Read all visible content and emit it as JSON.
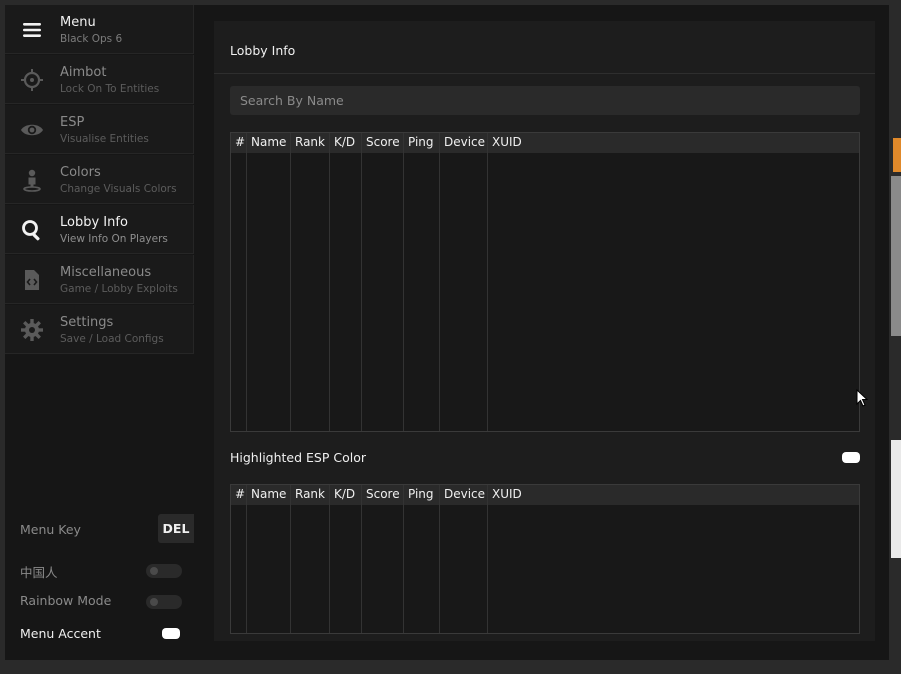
{
  "sidebar": {
    "header": {
      "title": "Menu",
      "subtitle": "Black Ops 6"
    },
    "items": [
      {
        "title": "Aimbot",
        "subtitle": "Lock On To Entities"
      },
      {
        "title": "ESP",
        "subtitle": "Visualise Entities"
      },
      {
        "title": "Colors",
        "subtitle": "Change Visuals Colors"
      },
      {
        "title": "Lobby Info",
        "subtitle": "View Info On Players"
      },
      {
        "title": "Miscellaneous",
        "subtitle": "Game / Lobby Exploits"
      },
      {
        "title": "Settings",
        "subtitle": "Save / Load Configs"
      }
    ],
    "active_index": 3,
    "options": {
      "menu_key_label": "Menu Key",
      "menu_key_value": "DEL",
      "chinese_label": "中国人",
      "chinese_enabled": false,
      "rainbow_label": "Rainbow Mode",
      "rainbow_enabled": false,
      "accent_label": "Menu Accent",
      "accent_color": "#ffffff"
    }
  },
  "main": {
    "title": "Lobby Info",
    "search_placeholder": "Search By Name",
    "columns": [
      "#",
      "Name",
      "Rank",
      "K/D",
      "Score",
      "Ping",
      "Device",
      "XUID"
    ],
    "highlight_label": "Highlighted ESP Color",
    "highlight_color": "#ffffff"
  },
  "colors": {
    "panel": "#1d1d1d",
    "sidebar": "#1a1a1a",
    "text": "#f0f0f0",
    "muted": "#8a8a8a"
  }
}
